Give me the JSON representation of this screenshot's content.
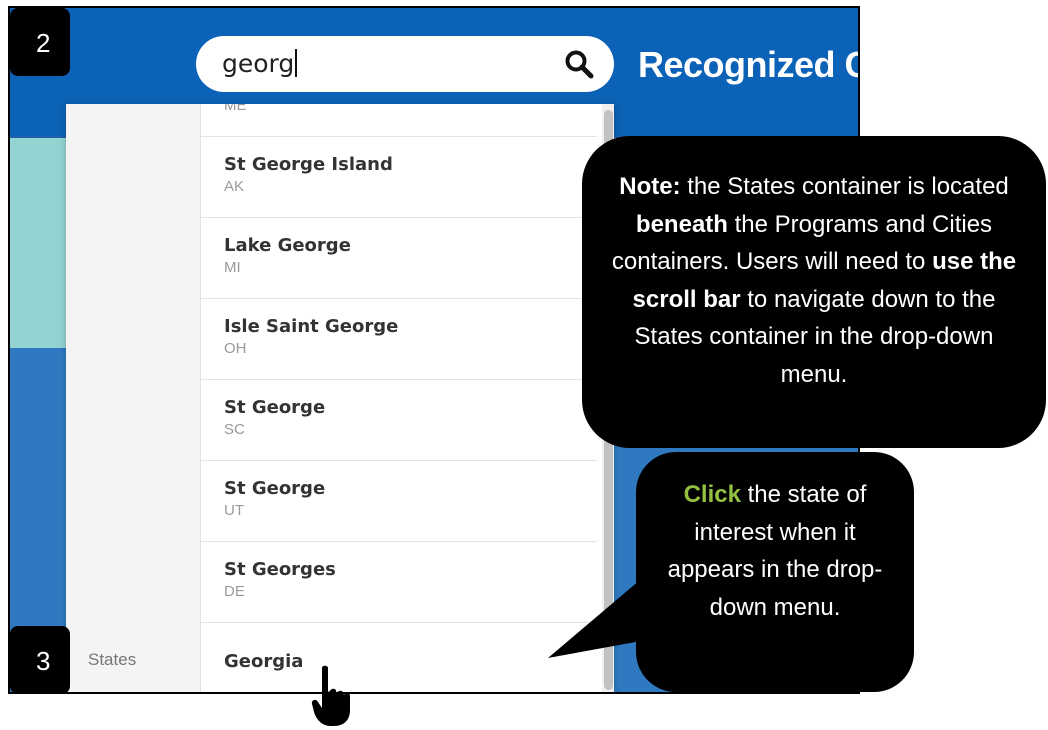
{
  "search": {
    "value": "georg"
  },
  "page": {
    "title": "Recognized C"
  },
  "dropdown": {
    "category_label": "States",
    "items": [
      {
        "name": "St George Island",
        "state": "AK"
      },
      {
        "name": "Lake George",
        "state": "MI"
      },
      {
        "name": "Isle Saint George",
        "state": "OH"
      },
      {
        "name": "St George",
        "state": "SC"
      },
      {
        "name": "St George",
        "state": "UT"
      },
      {
        "name": "St Georges",
        "state": "DE"
      },
      {
        "name": "Georgia",
        "state": ""
      }
    ],
    "partial_top_state": "ME"
  },
  "steps": {
    "step_2": "2",
    "step_3": "3"
  },
  "note": {
    "lead": "Note:",
    "text_1": " the States container is located ",
    "bold_1": "beneath",
    "text_2": " the Programs and Cities containers. Users will need to ",
    "bold_2": "use the scroll bar",
    "text_3": " to navigate down to the States container in the drop-down menu."
  },
  "click_tip": {
    "lead": "Click",
    "text": " the state of interest when it appears in the drop-down menu."
  },
  "colors": {
    "header_blue": "#0c62b6",
    "teal": "#93d3d2",
    "body_blue": "#2f79c0",
    "click_green": "#94c140"
  },
  "icons": {
    "search": "search-icon",
    "cursor": "hand-pointer-icon"
  }
}
